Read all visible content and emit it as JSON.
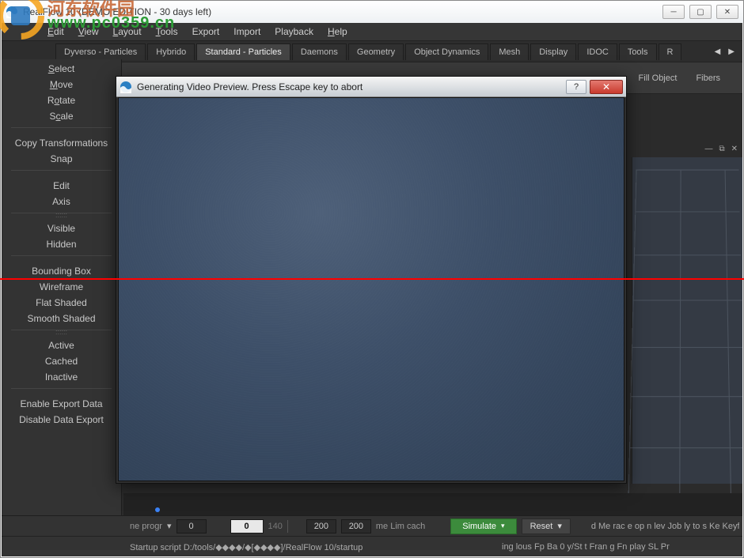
{
  "window": {
    "title": "RealFlow 10  (DEMO EDITION - 30 days left)",
    "min": "─",
    "max": "▢",
    "close": "✕"
  },
  "watermark": {
    "chinese": "河东软件园",
    "url": "www.pc0359.cn"
  },
  "menubar": [
    "Edit",
    "View",
    "Layout",
    "Tools",
    "Export",
    "Import",
    "Playback",
    "Help"
  ],
  "shelf": {
    "tabs": [
      "Dyverso - Particles",
      "Hybrido",
      "Standard - Particles",
      "Daemons",
      "Geometry",
      "Object Dynamics",
      "Mesh",
      "Display",
      "IDOC",
      "Tools",
      "R"
    ],
    "active_index": 2,
    "left": "◀",
    "right": "▶"
  },
  "sub_toolbar": {
    "fill_object": "Fill Object",
    "fibers": "Fibers"
  },
  "viewport_hdr": {
    "float": "⧉",
    "close": "✕",
    "dash": "—"
  },
  "sidebar": {
    "g1": [
      "Select",
      "Move",
      "Rotate",
      "Scale"
    ],
    "g2": [
      "Copy Transformations",
      "Snap"
    ],
    "g3": [
      "Edit",
      "Axis"
    ],
    "g4": [
      "Visible",
      "Hidden"
    ],
    "g5": [
      "Bounding Box",
      "Wireframe",
      "Flat Shaded",
      "Smooth Shaded"
    ],
    "g6": [
      "Active",
      "Cached",
      "Inactive"
    ],
    "g7": [
      "Enable Export Data",
      "Disable Data Export"
    ]
  },
  "dialog": {
    "title": "Generating Video Preview. Press Escape key to abort",
    "help": "?",
    "close": "✕"
  },
  "bottom": {
    "prog_label": "ne progr",
    "prog_caret": "▾",
    "f0": "0",
    "current": "0",
    "end": "140",
    "f200a": "200",
    "f200b": "200",
    "cache_label": "me Lim  cach",
    "simulate": "Simulate",
    "reset": "Reset",
    "caret": "▾",
    "right_status1": "d Me rac e op n lev   Job ly  to       s Ke  Keyf t  the",
    "startup": "Startup script D:/tools/◆◆◆◆/◆[◆◆◆◆]/RealFlow 10/startup",
    "right_status2": "ing lous Fp  Ba   0              y/St t Fran g Fn   play  SL Pr"
  }
}
